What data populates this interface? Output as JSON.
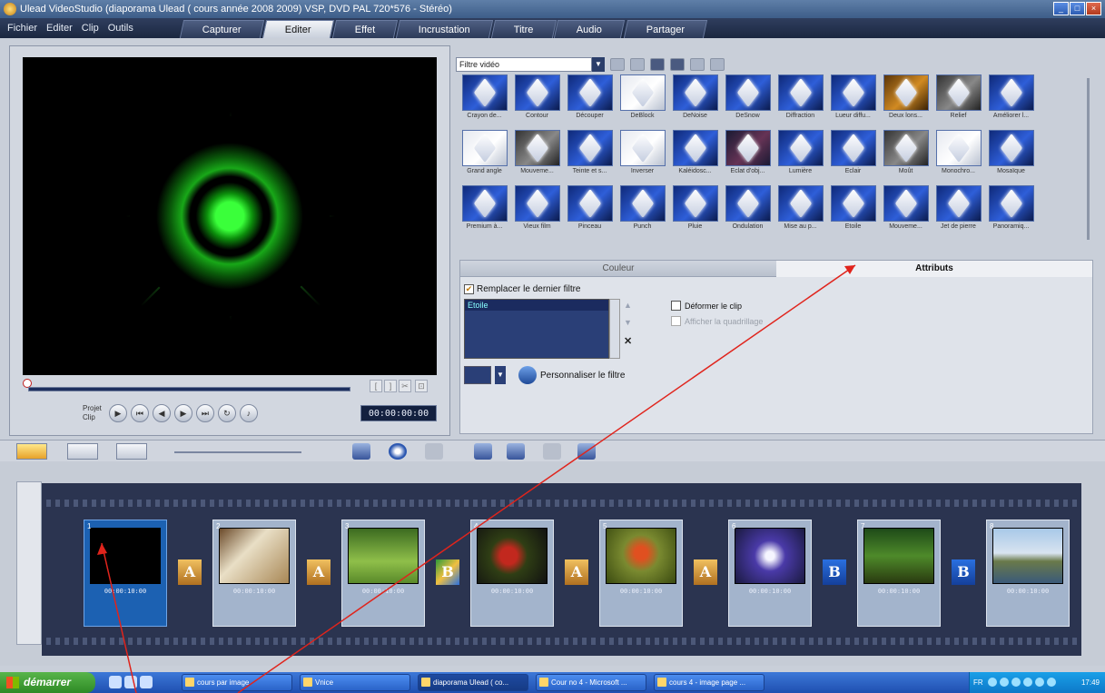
{
  "window": {
    "title": "Ulead VideoStudio (diaporama Ulead ( cours année 2008 2009) VSP, DVD PAL 720*576 - Stéréo)"
  },
  "menu": [
    "Fichier",
    "Editer",
    "Clip",
    "Outils"
  ],
  "tabs": [
    {
      "label": "Capturer",
      "active": false
    },
    {
      "label": "Editer",
      "active": true
    },
    {
      "label": "Effet",
      "active": false
    },
    {
      "label": "Incrustation",
      "active": false
    },
    {
      "label": "Titre",
      "active": false
    },
    {
      "label": "Audio",
      "active": false
    },
    {
      "label": "Partager",
      "active": false
    }
  ],
  "preview": {
    "project_label": "Projet",
    "clip_label": "Clip",
    "timecode": "00:00:00:00"
  },
  "library": {
    "category": "Filtre vidéo",
    "filters": [
      "Crayon de...",
      "Contour",
      "Découper",
      "DeBlock",
      "DeNoise",
      "DeSnow",
      "Diffraction",
      "Lueur diffu...",
      "Deux lons...",
      "Relief",
      "Améliorer l...",
      "Grand angle",
      "Mouveme...",
      "Teinte et s...",
      "Inverser",
      "Kaléidosc...",
      "Eclat d'obj...",
      "Lumière",
      "Eclair",
      "Moût",
      "Monochro...",
      "Mosaïque",
      "Premium à...",
      "Vieux film",
      "Pinceau",
      "Punch",
      "Pluie",
      "Ondulation",
      "Mise au p...",
      "Etoile",
      "Mouveme...",
      "Jet de pierre",
      "Panoramiq..."
    ]
  },
  "options": {
    "tab_color": "Couleur",
    "tab_attributes": "Attributs",
    "replace_last_filter": "Remplacer le dernier filtre",
    "applied_filter": "Etoile",
    "distort_clip": "Déformer le clip",
    "show_grid": "Afficher la quadrillage",
    "customize_filter": "Personnaliser le filtre"
  },
  "storyboard": {
    "clips": [
      {
        "num": "1",
        "time": "00:00:10:00"
      },
      {
        "num": "2",
        "time": "00:00:10:00"
      },
      {
        "num": "3",
        "time": "00:00:10:00"
      },
      {
        "num": "4",
        "time": "00:00:10:00"
      },
      {
        "num": "5",
        "time": "00:00:10:00"
      },
      {
        "num": "6",
        "time": "00:00:10:00"
      },
      {
        "num": "7",
        "time": "00:00:10:00"
      },
      {
        "num": "8",
        "time": "00:00:10:00"
      }
    ],
    "transitions": [
      "A",
      "A",
      "B",
      "A",
      "A",
      "B",
      "B"
    ]
  },
  "taskbar": {
    "start": "démarrer",
    "tasks": [
      "cours par image",
      "Vnice",
      "diaporama Ulead ( co...",
      "Cour no 4 - Microsoft ...",
      "cours 4 - image page ..."
    ],
    "lang": "FR",
    "clock": "17:49"
  },
  "colors": {
    "accent_blue": "#1c61b2",
    "annotation_red": "#e0241c"
  }
}
